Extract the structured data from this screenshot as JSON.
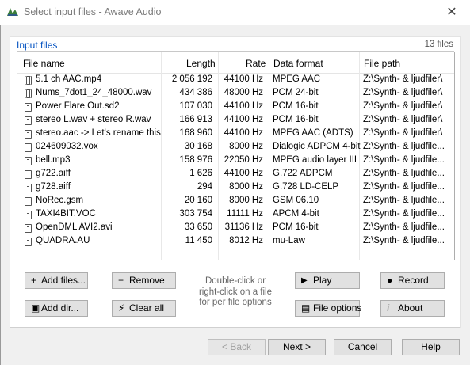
{
  "window": {
    "title": "Select input files - Awave Audio",
    "close_symbol": "✕"
  },
  "section": {
    "title": "Input files",
    "count": "13 files"
  },
  "columns": {
    "name": "File name",
    "length": "Length",
    "rate": "Rate",
    "format": "Data format",
    "path": "File path"
  },
  "files": [
    {
      "icon": "film",
      "name": "5.1 ch AAC.mp4",
      "length": "2 056 192",
      "rate": "44100 Hz",
      "format": "MPEG AAC",
      "path": "Z:\\Synth- & ljudfiler\\"
    },
    {
      "icon": "film",
      "name": "Nums_7dot1_24_48000.wav",
      "length": "434 386",
      "rate": "48000 Hz",
      "format": "PCM 24-bit",
      "path": "Z:\\Synth- & ljudfiler\\"
    },
    {
      "icon": "doc",
      "name": "Power Flare Out.sd2",
      "length": "107 030",
      "rate": "44100 Hz",
      "format": "PCM 16-bit",
      "path": "Z:\\Synth- & ljudfiler\\"
    },
    {
      "icon": "doc",
      "name": "stereo L.wav + stereo R.wav",
      "length": "166 913",
      "rate": "44100 Hz",
      "format": "PCM 16-bit",
      "path": "Z:\\Synth- & ljudfiler\\"
    },
    {
      "icon": "doc",
      "name": "stereo.aac -> Let's rename this",
      "length": "168 960",
      "rate": "44100 Hz",
      "format": "MPEG AAC (ADTS)",
      "path": "Z:\\Synth- & ljudfiler\\"
    },
    {
      "icon": "doc",
      "name": "024609032.vox",
      "length": "30 168",
      "rate": "8000 Hz",
      "format": "Dialogic ADPCM 4-bit",
      "path": "Z:\\Synth- & ljudfile..."
    },
    {
      "icon": "doc",
      "name": "bell.mp3",
      "length": "158 976",
      "rate": "22050 Hz",
      "format": "MPEG audio layer III",
      "path": "Z:\\Synth- & ljudfile..."
    },
    {
      "icon": "doc",
      "name": "g722.aiff",
      "length": "1 626",
      "rate": "44100 Hz",
      "format": "G.722 ADPCM",
      "path": "Z:\\Synth- & ljudfile..."
    },
    {
      "icon": "doc",
      "name": "g728.aiff",
      "length": "294",
      "rate": "8000 Hz",
      "format": "G.728 LD-CELP",
      "path": "Z:\\Synth- & ljudfile..."
    },
    {
      "icon": "doc",
      "name": "NoRec.gsm",
      "length": "20 160",
      "rate": "8000 Hz",
      "format": "GSM 06.10",
      "path": "Z:\\Synth- & ljudfile..."
    },
    {
      "icon": "doc",
      "name": "TAXI4BIT.VOC",
      "length": "303 754",
      "rate": "11111 Hz",
      "format": "APCM 4-bit",
      "path": "Z:\\Synth- & ljudfile..."
    },
    {
      "icon": "doc",
      "name": "OpenDML AVI2.avi",
      "length": "33 650",
      "rate": "31136 Hz",
      "format": "PCM 16-bit",
      "path": "Z:\\Synth- & ljudfile..."
    },
    {
      "icon": "doc",
      "name": "QUADRA.AU",
      "length": "11 450",
      "rate": "8012 Hz",
      "format": "mu-Law",
      "path": "Z:\\Synth- & ljudfile..."
    }
  ],
  "actions": {
    "add_files": {
      "label": "Add files...",
      "icon": "+"
    },
    "remove": {
      "label": "Remove",
      "icon": "−"
    },
    "add_dir": {
      "label": "Add dir...",
      "icon": "▣"
    },
    "clear_all": {
      "label": "Clear all",
      "icon": "⚡"
    },
    "play": {
      "label": "Play",
      "icon": "▶"
    },
    "record": {
      "label": "Record",
      "icon": "●"
    },
    "file_options": {
      "label": "File options",
      "icon": "▤"
    },
    "about": {
      "label": "About",
      "icon": "i"
    }
  },
  "hint": "Double-click or right-click on a file for per file options",
  "footer": {
    "back": "< Back",
    "next": "Next >",
    "cancel": "Cancel",
    "help": "Help"
  }
}
